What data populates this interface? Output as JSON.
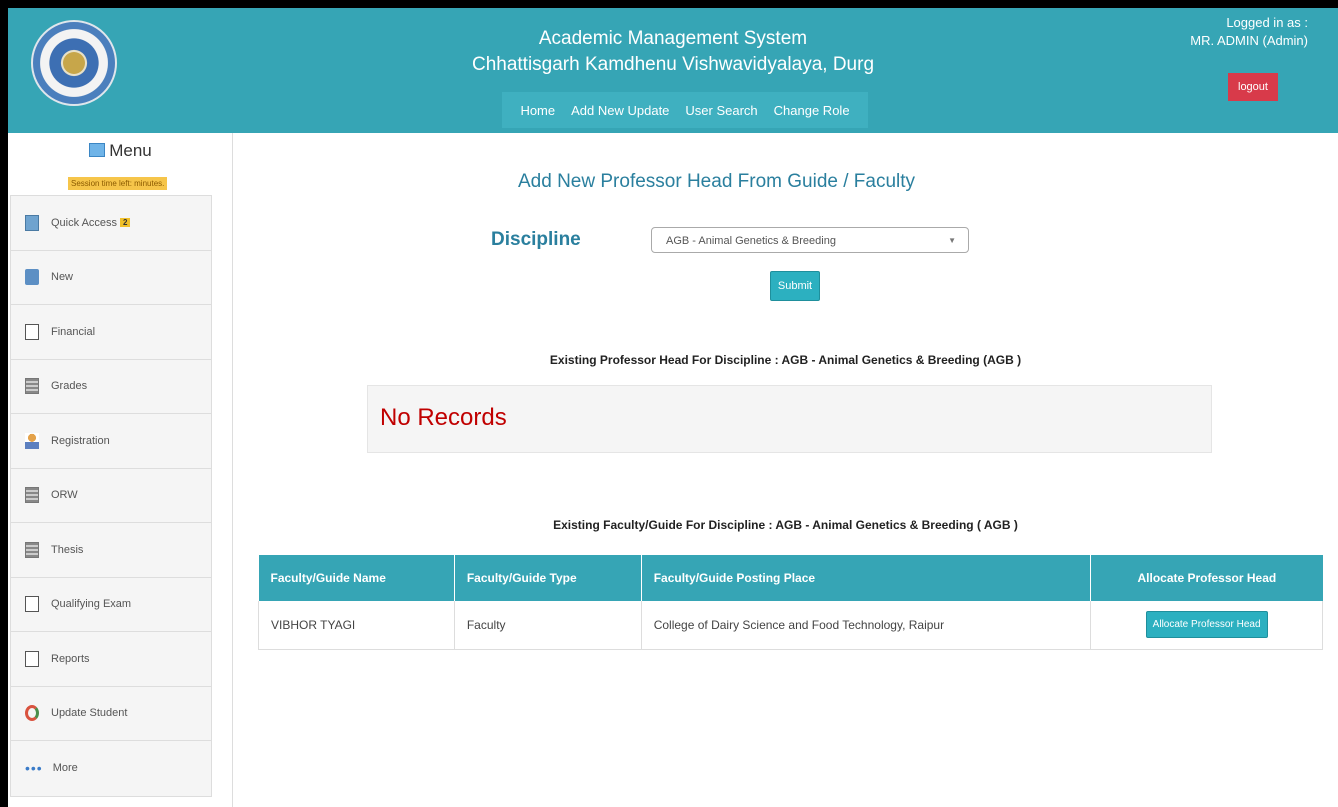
{
  "header": {
    "title_line1": "Academic Management System",
    "title_line2": "Chhattisgarh Kamdhenu Vishwavidyalaya, Durg",
    "nav": [
      "Home",
      "Add New Update",
      "User Search",
      "Change Role"
    ],
    "logged_in_label": "Logged in as :",
    "user": "MR. ADMIN (Admin)",
    "logout_label": "logout"
  },
  "sidebar": {
    "menu_title": "Menu",
    "session_text": "Session time left: minutes.",
    "items": [
      {
        "label": "Quick Access",
        "icon": "quick-access-icon",
        "badge": "2"
      },
      {
        "label": "New",
        "icon": "new-file-icon"
      },
      {
        "label": "Financial",
        "icon": "financial-icon"
      },
      {
        "label": "Grades",
        "icon": "grades-icon"
      },
      {
        "label": "Registration",
        "icon": "registration-icon"
      },
      {
        "label": "ORW",
        "icon": "orw-icon"
      },
      {
        "label": "Thesis",
        "icon": "thesis-icon"
      },
      {
        "label": "Qualifying Exam",
        "icon": "qualifying-exam-icon"
      },
      {
        "label": "Reports",
        "icon": "reports-icon"
      },
      {
        "label": "Update Student",
        "icon": "update-student-icon"
      },
      {
        "label": "More",
        "icon": "more-dots-icon"
      }
    ]
  },
  "main": {
    "page_title": "Add New Professor Head From Guide / Faculty",
    "discipline_label": "Discipline",
    "discipline_selected": "AGB - Animal Genetics & Breeding",
    "submit_label": "Submit",
    "existing_head_heading": "Existing Professor Head For Discipline : AGB - Animal Genetics & Breeding (AGB )",
    "no_records": "No Records",
    "existing_faculty_heading": "Existing Faculty/Guide For Discipline : AGB - Animal Genetics & Breeding ( AGB )",
    "table": {
      "columns": [
        "Faculty/Guide Name",
        "Faculty/Guide Type",
        "Faculty/Guide Posting Place",
        "Allocate Professor Head"
      ],
      "rows": [
        {
          "name": "VIBHOR TYAGI",
          "type": "Faculty",
          "place": "College of Dairy Science and Food Technology, Raipur",
          "action": "Allocate Professor Head"
        }
      ]
    }
  },
  "colors": {
    "header_teal": "#36a5b5",
    "title_teal": "#2a7f9e",
    "logout_red": "#d83a4a",
    "no_records_red": "#c00000"
  }
}
